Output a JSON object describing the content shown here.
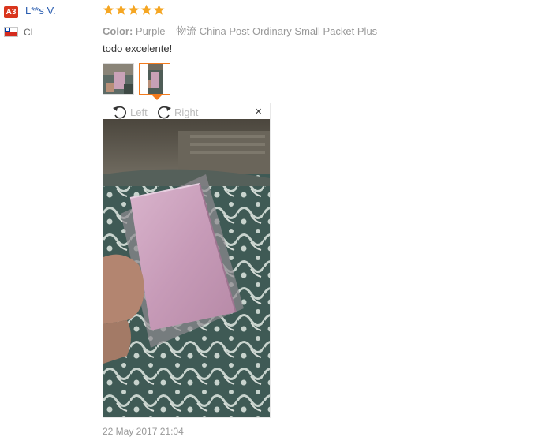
{
  "reviewer": {
    "badge": "A3",
    "name": "L**s V.",
    "country": "CL",
    "flag_icon": "chile-flag-icon"
  },
  "rating": {
    "stars": 5,
    "max": 5,
    "color": "#f5a623"
  },
  "meta": {
    "color_label": "Color:",
    "color_value": "Purple",
    "shipping_label": "物流",
    "shipping_value": "China Post Ordinary Small Packet Plus"
  },
  "review": {
    "text": "todo excelente!"
  },
  "viewer": {
    "rotate_left_label": "Left",
    "rotate_right_label": "Right",
    "close_label": "×",
    "selected_thumbnail": 2
  },
  "footer": {
    "date": "22 May 2017 21:04"
  },
  "colors": {
    "accent": "#f37b1d",
    "link": "#2a5db0",
    "badge": "#d9351d"
  }
}
